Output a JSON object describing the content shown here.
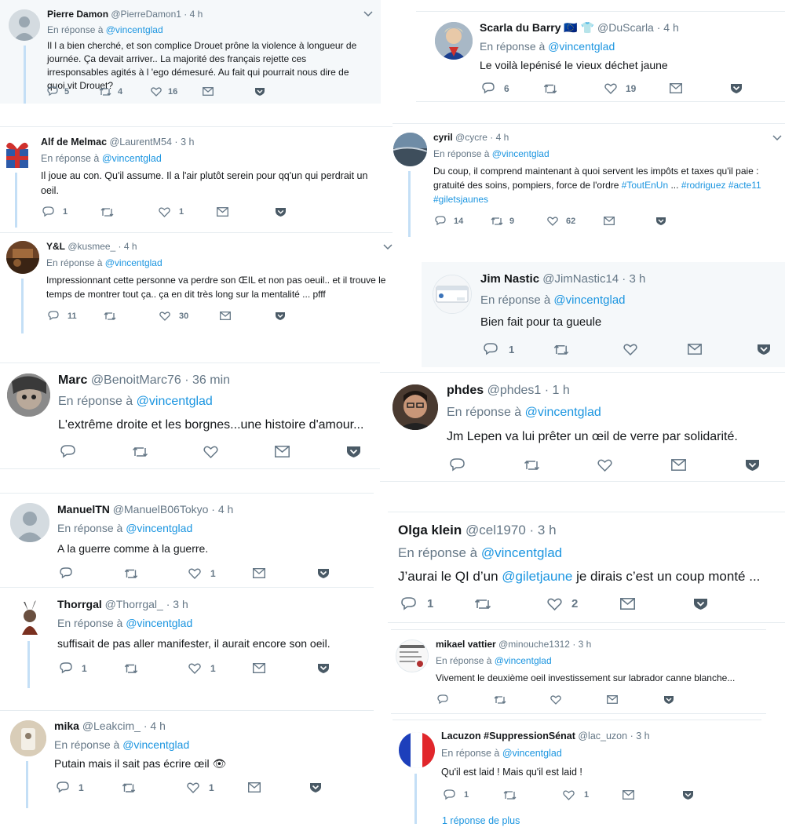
{
  "reply_prefix": "En réponse à",
  "reply_to": "@vincentglad",
  "tweets": [
    {
      "name": "Pierre Damon",
      "handle": "@PierreDamon1",
      "time": "4 h",
      "text": "Il l a bien cherché, et son complice Drouet prône la violence à longueur de journée. Ça devait arriver..  La majorité des français rejette ces irresponsables agités à l 'ego démesuré. Au fait qui pourrait nous dire de quoi vit Drouet?",
      "replies": "5",
      "retweets": "4",
      "likes": "16"
    },
    {
      "name": "Alf de Melmac",
      "handle": "@LaurentM54",
      "time": "3 h",
      "text": "Il joue au con. Qu'il assume. Il a l'air plutôt serein pour qq'un qui perdrait un oeil.",
      "replies": "1",
      "retweets": "",
      "likes": "1"
    },
    {
      "name": "Y&L",
      "handle": "@kusmee_",
      "time": "4 h",
      "text": "Impressionnant cette personne va perdre son ŒIL et non pas oeuil.. et il trouve le temps de montrer tout ça.. ça en dit très long sur la mentalité ... pfff",
      "replies": "11",
      "retweets": "",
      "likes": "30"
    },
    {
      "name": "Marc",
      "handle": "@BenoitMarc76",
      "time": "36 min",
      "text": "L'extrême droite et les borgnes...une histoire d'amour...",
      "replies": "",
      "retweets": "",
      "likes": ""
    },
    {
      "name": "ManuelTN",
      "handle": "@ManuelB06Tokyo",
      "time": "4 h",
      "text": "A la guerre comme à la guerre.",
      "replies": "",
      "retweets": "",
      "likes": "1"
    },
    {
      "name": "Thorrgal",
      "handle": "@Thorrgal_",
      "time": "3 h",
      "text": "suffisait de pas aller manifester, il aurait encore son oeil.",
      "replies": "1",
      "retweets": "",
      "likes": "1"
    },
    {
      "name": "mika",
      "handle": "@Leakcim_",
      "time": "4 h",
      "text": "Putain mais il sait pas écrire œil",
      "emoji": "👁",
      "replies": "1",
      "retweets": "",
      "likes": "1"
    },
    {
      "name": "Scarla du Barry",
      "name_extra": "🇪🇺 👕",
      "handle": "@DuScarla",
      "time": "4 h",
      "text": "Le voilà lepénisé le vieux déchet jaune",
      "replies": "6",
      "retweets": "",
      "likes": "19"
    },
    {
      "name": "cyril",
      "handle": "@cycre",
      "time": "4 h",
      "text_pre": "Du coup, il comprend maintenant à quoi servent les impôts et taxes qu'il paie : gratuité des soins, pompiers, force de l'ordre ",
      "tags": [
        "#ToutEnUn",
        "...",
        "#rodriguez",
        "#acte11",
        "#giletsjaunes"
      ],
      "replies": "14",
      "retweets": "9",
      "likes": "62"
    },
    {
      "name": "Jim Nastic",
      "handle": "@JimNastic14",
      "time": "3 h",
      "text": "Bien fait pour ta gueule",
      "replies": "1",
      "retweets": "",
      "likes": ""
    },
    {
      "name": "phdes",
      "handle": "@phdes1",
      "time": "1 h",
      "text": "Jm Lepen va lui prêter un œil de verre par solidarité.",
      "replies": "",
      "retweets": "",
      "likes": ""
    },
    {
      "name": "Olga klein",
      "handle": "@cel1970",
      "time": "3 h",
      "text_pre": "J’aurai le QI d’un ",
      "mention": "@giletjaune",
      "text_post": " je dirais c’est un coup monté ...",
      "replies": "1",
      "retweets": "",
      "likes": "2"
    },
    {
      "name": "mikael vattier",
      "handle": "@minouche1312",
      "time": "3 h",
      "text": "Vivement le deuxième oeil investissement sur labrador canne blanche...",
      "replies": "",
      "retweets": "",
      "likes": ""
    },
    {
      "name": "Lacuzon #SuppressionSénat",
      "handle": "@lac_uzon",
      "time": "3 h",
      "text": "Qu'il est laid ! Mais qu'il est laid !",
      "replies": "1",
      "retweets": "",
      "likes": "1",
      "more": "1 réponse de plus"
    }
  ],
  "colors": {
    "link": "#1b95e0",
    "muted": "#657786",
    "text": "#14171a",
    "thread": "#c4dff6",
    "highlight": "#f5f8fa",
    "border": "#e6ecf0"
  }
}
